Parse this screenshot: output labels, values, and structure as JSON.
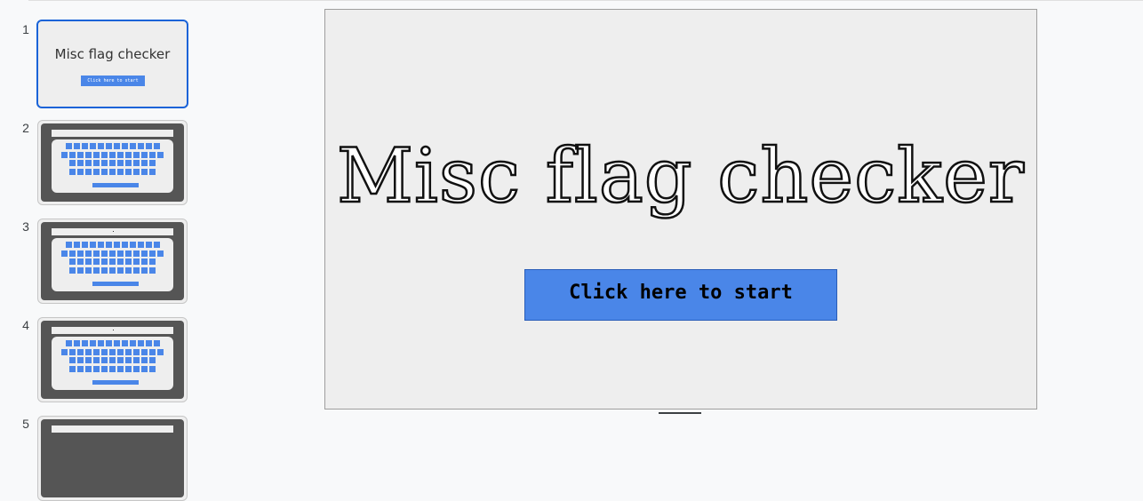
{
  "app": {
    "slide_count_visible": 5
  },
  "sidebar": {
    "slides": [
      {
        "number": "1",
        "title": "Misc flag checker",
        "button": "Click here to start",
        "selected": true
      },
      {
        "number": "2",
        "kind": "keyboard"
      },
      {
        "number": "3",
        "kind": "keyboard"
      },
      {
        "number": "4",
        "kind": "keyboard"
      },
      {
        "number": "5",
        "kind": "keyboard"
      }
    ]
  },
  "slide": {
    "title": "Misc flag checker",
    "start_button": "Click here to start"
  },
  "colors": {
    "accent": "#4a86e8",
    "selection": "#1a63d8",
    "slide_bg": "#eeeeee",
    "keyboard_frame": "#555555"
  }
}
